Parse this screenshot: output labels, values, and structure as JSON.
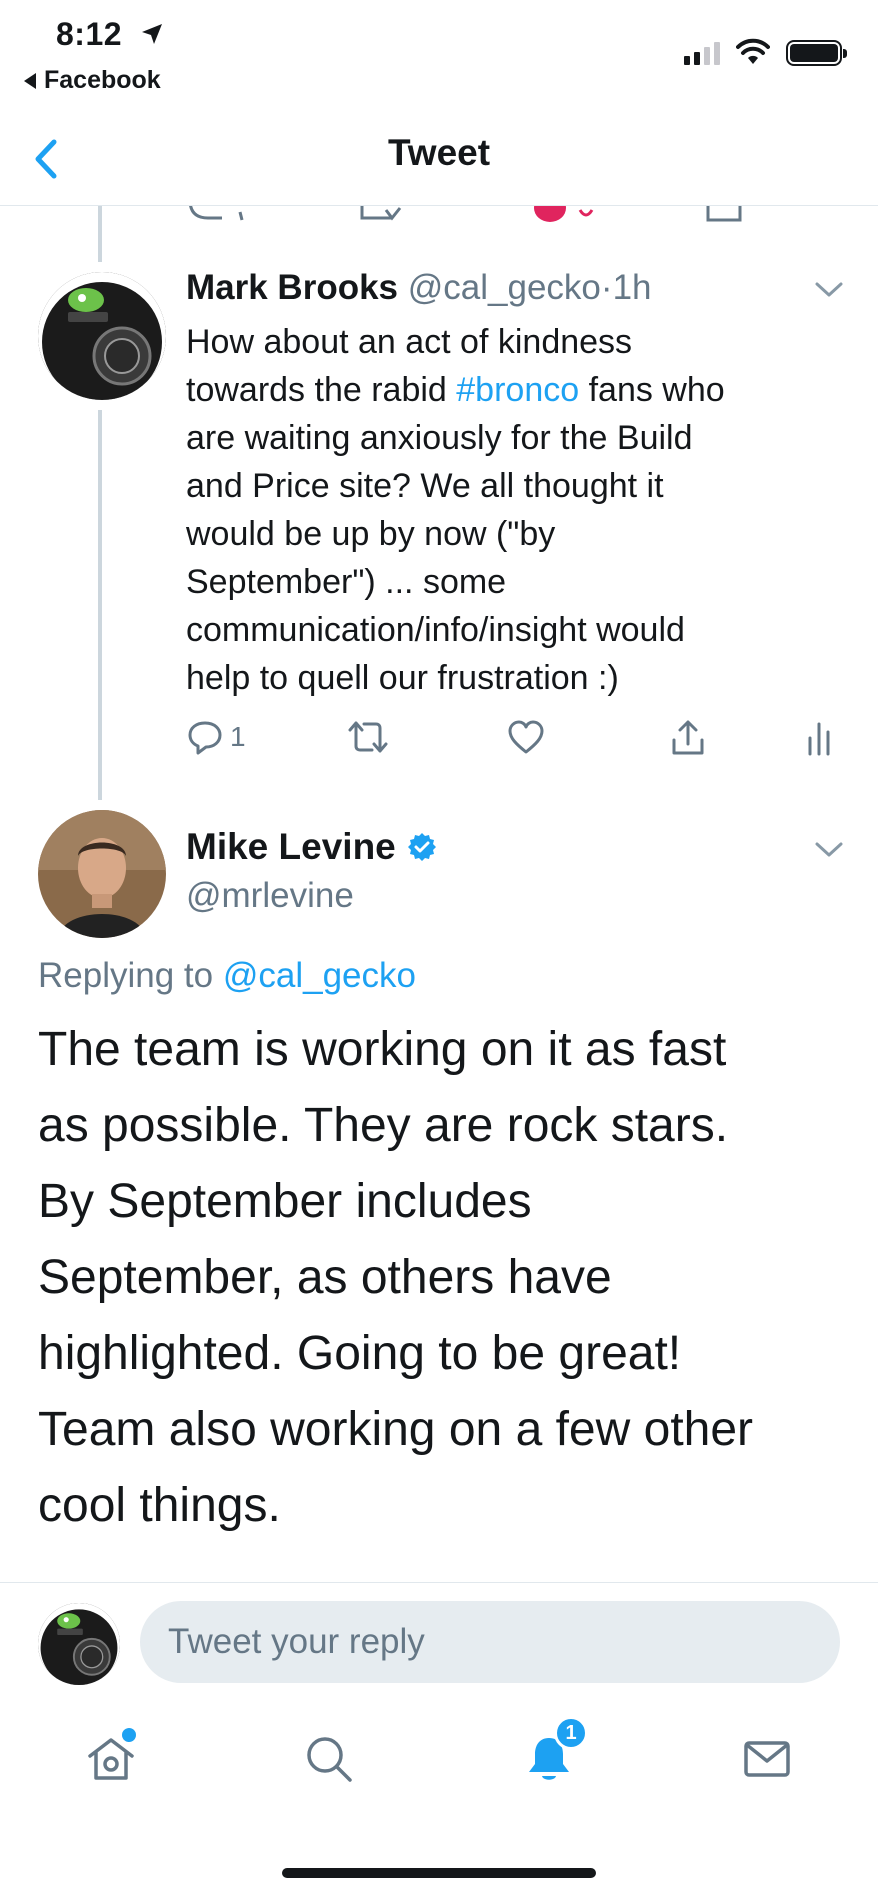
{
  "status_bar": {
    "time": "8:12",
    "back_app": "Facebook"
  },
  "nav": {
    "title": "Tweet"
  },
  "parent_tweet": {
    "name": "Mark Brooks",
    "handle": "@cal_gecko",
    "separator": "·",
    "time_ago": "1h",
    "text_lines": [
      "How about an act of kindness",
      "towards the rabid ",
      "are waiting anxiously for the Build",
      "and Price site? We all thought it",
      "would be up by now (\"by",
      "September\") ... some",
      "communication/info/insight would",
      "help to quell our frustration :)"
    ],
    "hashtag": "#bronco",
    "hashtag_suffix": " fans who",
    "reply_count": "1"
  },
  "main_tweet": {
    "name": "Mike Levine",
    "verified": true,
    "handle": "@mrlevine",
    "replying_prefix": "Replying to ",
    "replying_to": "@cal_gecko",
    "text_lines": [
      "The team is working on it as fast",
      "as possible. They are rock stars.",
      "By September includes",
      "September, as others have",
      "highlighted. Going to be great!",
      "Team also working on a few other",
      "cool things."
    ]
  },
  "reply_bar": {
    "placeholder": "Tweet your reply"
  },
  "tabbar": {
    "notifications_badge": "1"
  },
  "colors": {
    "accent": "#1da1f2",
    "secondary_text": "#657786",
    "primary_text": "#14171a",
    "divider": "#e1e8ed",
    "like_red": "#e0245e"
  },
  "icons": [
    "location-arrow-icon",
    "signal-icon",
    "wifi-icon",
    "battery-icon",
    "back-chevron-icon",
    "chevron-down-icon",
    "reply-icon",
    "retweet-icon",
    "like-icon",
    "share-icon",
    "analytics-icon",
    "verified-icon",
    "home-icon",
    "search-icon",
    "notifications-icon",
    "messages-icon"
  ]
}
